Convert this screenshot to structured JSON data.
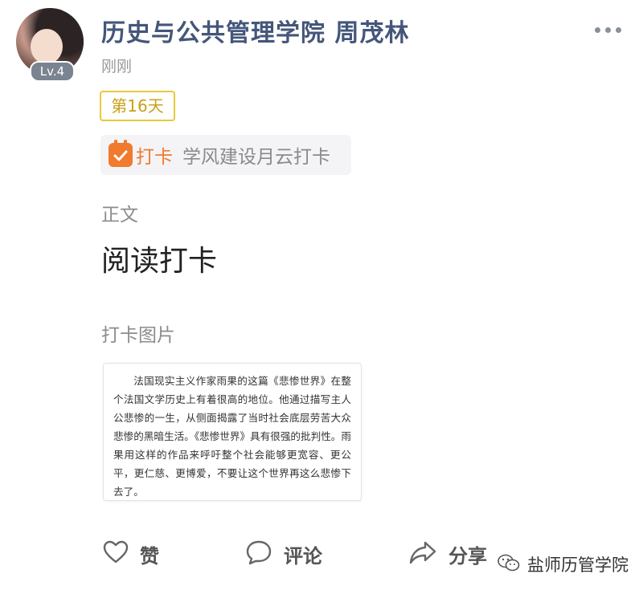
{
  "post": {
    "author": "历史与公共管理学院 周茂林",
    "level": "Lv.4",
    "time": "刚刚",
    "day_badge": "第16天",
    "checkin_label": "打卡",
    "checkin_topic": "学风建设月云打卡",
    "body_label": "正文",
    "body_text": "阅读打卡",
    "image_label": "打卡图片",
    "image_text": "法国现实主义作家雨果的这篇《悲惨世界》在整个法国文学历史上有着很高的地位。他通过描写主人公悲惨的一生，从侧面揭露了当时社会底层劳苦大众悲惨的黑暗生活。《悲惨世界》具有很强的批判性。雨果用这样的作品来呼吁整个社会能够更宽容、更公平，更仁慈、更博爱，不要让这个世界再这么悲惨下去了。"
  },
  "actions": {
    "like": "赞",
    "comment": "评论",
    "share": "分享"
  },
  "watermark": "盐师历管学院",
  "icons": {
    "more": "more-dots-icon",
    "calendar": "calendar-check-icon",
    "like": "heart-icon",
    "comment": "comment-bubble-icon",
    "share": "share-arrow-icon",
    "wechat": "wechat-icon"
  },
  "colors": {
    "author": "#44567a",
    "checkin_accent": "#f07a2e",
    "day_badge": "#e8c93a"
  }
}
